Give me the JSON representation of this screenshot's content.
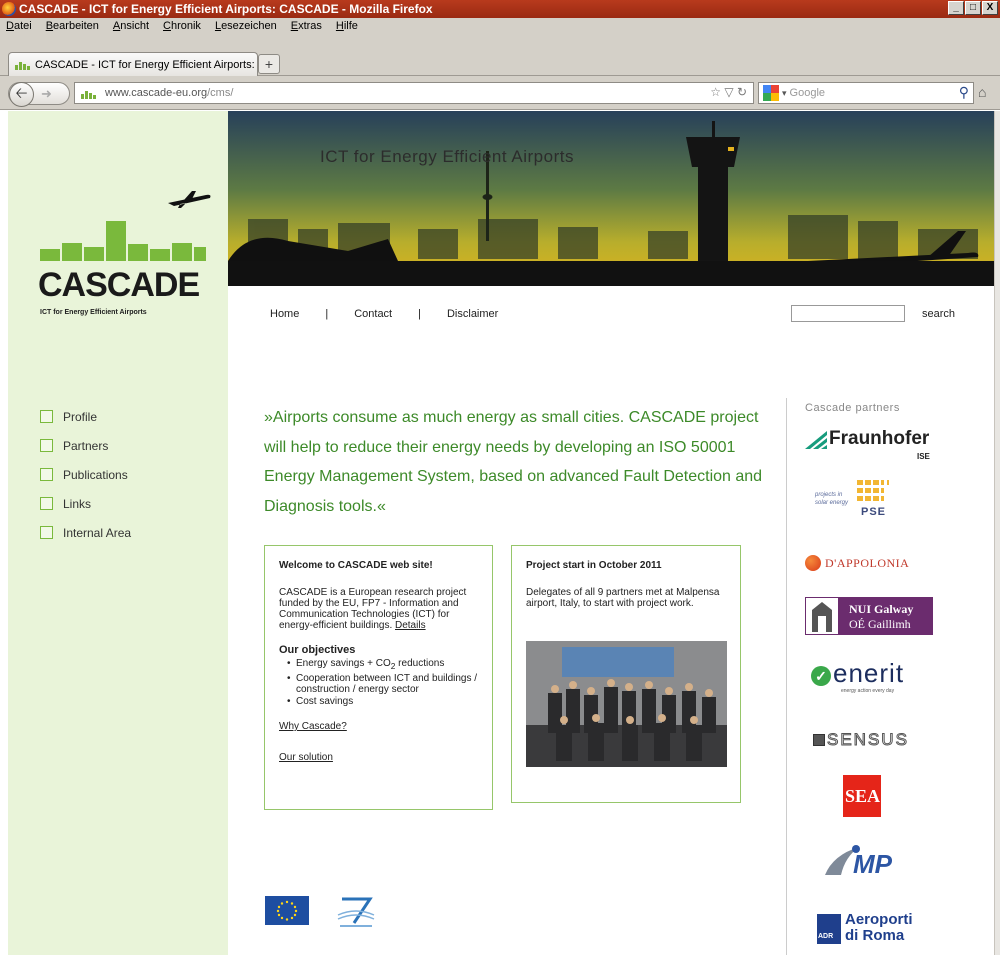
{
  "window": {
    "title": "CASCADE - ICT for Energy Efficient Airports: CASCADE - Mozilla Firefox",
    "buttons": {
      "minimize": "_",
      "maximize": "□",
      "close": "X"
    }
  },
  "menu": [
    "Datei",
    "Bearbeiten",
    "Ansicht",
    "Chronik",
    "Lesezeichen",
    "Extras",
    "Hilfe"
  ],
  "tab": {
    "label": "CASCADE - ICT for Energy Efficient Airports: ...",
    "new_tab": "+"
  },
  "nav": {
    "url_host": "www.cascade-eu.org",
    "url_path": "/cms/",
    "search_placeholder": "Google"
  },
  "site": {
    "logo_word": "CASCADE",
    "logo_sub": "ICT for Energy Efficient Airports",
    "banner_title": "ICT for Energy Efficient Airports",
    "top_nav": [
      "Home",
      "Contact",
      "Disclaimer"
    ],
    "top_nav_sep": "|",
    "search_label": "search",
    "side_nav": [
      "Profile",
      "Partners",
      "Publications",
      "Links",
      "Internal Area"
    ],
    "quote": "»Airports consume as much energy as small cities. CASCADE project will help to reduce their energy needs by developing an ISO 50001 Energy Management System, based on advanced Fault Detection and Diagnosis tools.«",
    "welcome": {
      "title": "Welcome to CASCADE web site!",
      "intro": "CASCADE is a European research project funded by the EU, FP7 - Information and Communication Technologies (ICT) for energy-efficient buildings.",
      "details_link": "Details",
      "objectives_title": "Our objectives",
      "objective_1_pre": "Energy savings + CO",
      "objective_1_sub": "2",
      "objective_1_post": " reductions",
      "objective_2": "Cooperation between ICT and buildings / construction / energy sector",
      "objective_3": "Cost savings",
      "why_link": "Why Cascade?",
      "solution_link": "Our solution"
    },
    "project": {
      "title": "Project start in October 2011",
      "text": "Delegates of all 9 partners met at Malpensa airport, Italy, to start with project work."
    },
    "partners_title": "Cascade partners",
    "partners": {
      "fraunhofer": "Fraunhofer",
      "fraunhofer_sub": "ISE",
      "pse_top": "projects in",
      "pse_mid": "solar energy",
      "pse_word": "PSE",
      "dappolonia": "D'APPOLONIA",
      "nui_1": "NUI Galway",
      "nui_2": "OÉ Gaillimh",
      "enerit": "enerit",
      "enerit_sub": "energy action every day",
      "sensus": "SENSUS",
      "sea": "SEA",
      "mp": "MP",
      "adr_1": "Aeroporti",
      "adr_2": "di Roma",
      "adr_badge": "ADR"
    }
  }
}
